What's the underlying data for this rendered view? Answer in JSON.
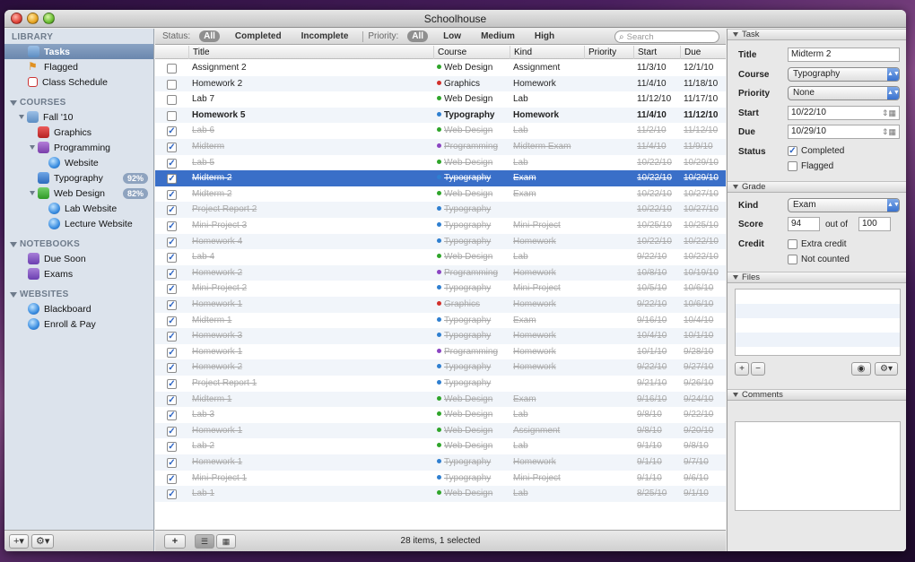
{
  "window": {
    "title": "Schoolhouse"
  },
  "sidebar": {
    "library_label": "LIBRARY",
    "library": [
      {
        "label": "Tasks",
        "icon": "tasks-icon",
        "selected": true
      },
      {
        "label": "Flagged",
        "icon": "flag-icon"
      },
      {
        "label": "Class Schedule",
        "icon": "calendar-icon"
      }
    ],
    "courses_label": "COURSES",
    "courses": [
      {
        "label": "Fall '10",
        "icon": "folder-icon",
        "indent": 1,
        "disclosure": true
      },
      {
        "label": "Graphics",
        "icon": "book-icon",
        "color": "red",
        "indent": 2
      },
      {
        "label": "Programming",
        "icon": "book-icon",
        "color": "purple",
        "indent": 2,
        "disclosure": true
      },
      {
        "label": "Website",
        "icon": "globe-icon",
        "indent": 3
      },
      {
        "label": "Typography",
        "icon": "book-icon",
        "color": "blue",
        "indent": 2,
        "badge": "92%"
      },
      {
        "label": "Web Design",
        "icon": "book-icon",
        "color": "green",
        "indent": 2,
        "disclosure": true,
        "badge": "82%"
      },
      {
        "label": "Lab Website",
        "icon": "globe-icon",
        "indent": 3
      },
      {
        "label": "Lecture Website",
        "icon": "globe-icon",
        "indent": 3
      }
    ],
    "notebooks_label": "NOTEBOOKS",
    "notebooks": [
      {
        "label": "Due Soon",
        "icon": "notebook-icon"
      },
      {
        "label": "Exams",
        "icon": "notebook-icon"
      }
    ],
    "websites_label": "WEBSITES",
    "websites": [
      {
        "label": "Blackboard",
        "icon": "globe-icon"
      },
      {
        "label": "Enroll & Pay",
        "icon": "globe-icon"
      }
    ],
    "footer": {
      "add": "+▾",
      "gear": "⚙▾"
    }
  },
  "filters": {
    "status_label": "Status:",
    "status": [
      "All",
      "Completed",
      "Incomplete"
    ],
    "status_selected": 0,
    "priority_label": "Priority:",
    "priority": [
      "All",
      "Low",
      "Medium",
      "High"
    ],
    "priority_selected": 0,
    "search_placeholder": "Search"
  },
  "columns": [
    "Title",
    "Course",
    "Kind",
    "Priority",
    "Start",
    "Due"
  ],
  "course_colors": {
    "Web Design": "#2fa52a",
    "Graphics": "#d2302b",
    "Typography": "#2f7fd0",
    "Programming": "#8b45c2"
  },
  "tasks": [
    {
      "done": false,
      "bold": false,
      "title": "Assignment 2",
      "course": "Web Design",
      "kind": "Assignment",
      "priority": "",
      "start": "11/3/10",
      "due": "12/1/10"
    },
    {
      "done": false,
      "bold": false,
      "title": "Homework 2",
      "course": "Graphics",
      "kind": "Homework",
      "priority": "",
      "start": "11/4/10",
      "due": "11/18/10"
    },
    {
      "done": false,
      "bold": false,
      "title": "Lab 7",
      "course": "Web Design",
      "kind": "Lab",
      "priority": "",
      "start": "11/12/10",
      "due": "11/17/10"
    },
    {
      "done": false,
      "bold": true,
      "title": "Homework 5",
      "course": "Typography",
      "kind": "Homework",
      "priority": "",
      "start": "11/4/10",
      "due": "11/12/10"
    },
    {
      "done": true,
      "bold": false,
      "title": "Lab 6",
      "course": "Web Design",
      "kind": "Lab",
      "priority": "",
      "start": "11/2/10",
      "due": "11/12/10"
    },
    {
      "done": true,
      "bold": false,
      "title": "Midterm",
      "course": "Programming",
      "kind": "Midterm Exam",
      "priority": "",
      "start": "11/4/10",
      "due": "11/9/10"
    },
    {
      "done": true,
      "bold": false,
      "title": "Lab 5",
      "course": "Web Design",
      "kind": "Lab",
      "priority": "",
      "start": "10/22/10",
      "due": "10/29/10"
    },
    {
      "done": true,
      "bold": false,
      "title": "Midterm 2",
      "course": "Typography",
      "kind": "Exam",
      "priority": "",
      "start": "10/22/10",
      "due": "10/29/10",
      "selected": true
    },
    {
      "done": true,
      "bold": false,
      "title": "Midterm 2",
      "course": "Web Design",
      "kind": "Exam",
      "priority": "",
      "start": "10/22/10",
      "due": "10/27/10"
    },
    {
      "done": true,
      "bold": false,
      "title": "Project Report 2",
      "course": "Typography",
      "kind": "",
      "priority": "",
      "start": "10/22/10",
      "due": "10/27/10"
    },
    {
      "done": true,
      "bold": false,
      "title": "Mini-Project 3",
      "course": "Typography",
      "kind": "Mini-Project",
      "priority": "",
      "start": "10/25/10",
      "due": "10/25/10"
    },
    {
      "done": true,
      "bold": false,
      "title": "Homework 4",
      "course": "Typography",
      "kind": "Homework",
      "priority": "",
      "start": "10/22/10",
      "due": "10/22/10"
    },
    {
      "done": true,
      "bold": false,
      "title": "Lab 4",
      "course": "Web Design",
      "kind": "Lab",
      "priority": "",
      "start": "9/22/10",
      "due": "10/22/10"
    },
    {
      "done": true,
      "bold": false,
      "title": "Homework 2",
      "course": "Programming",
      "kind": "Homework",
      "priority": "",
      "start": "10/8/10",
      "due": "10/19/10"
    },
    {
      "done": true,
      "bold": false,
      "title": "Mini-Project 2",
      "course": "Typography",
      "kind": "Mini-Project",
      "priority": "",
      "start": "10/5/10",
      "due": "10/6/10"
    },
    {
      "done": true,
      "bold": false,
      "title": "Homework 1",
      "course": "Graphics",
      "kind": "Homework",
      "priority": "",
      "start": "9/22/10",
      "due": "10/6/10"
    },
    {
      "done": true,
      "bold": false,
      "title": "Midterm 1",
      "course": "Typography",
      "kind": "Exam",
      "priority": "",
      "start": "9/16/10",
      "due": "10/4/10"
    },
    {
      "done": true,
      "bold": false,
      "title": "Homework 3",
      "course": "Typography",
      "kind": "Homework",
      "priority": "",
      "start": "10/4/10",
      "due": "10/1/10"
    },
    {
      "done": true,
      "bold": false,
      "title": "Homework 1",
      "course": "Programming",
      "kind": "Homework",
      "priority": "",
      "start": "10/1/10",
      "due": "9/28/10"
    },
    {
      "done": true,
      "bold": false,
      "title": "Homework 2",
      "course": "Typography",
      "kind": "Homework",
      "priority": "",
      "start": "9/22/10",
      "due": "9/27/10"
    },
    {
      "done": true,
      "bold": false,
      "title": "Project Report 1",
      "course": "Typography",
      "kind": "",
      "priority": "",
      "start": "9/21/10",
      "due": "9/26/10"
    },
    {
      "done": true,
      "bold": false,
      "title": "Midterm 1",
      "course": "Web Design",
      "kind": "Exam",
      "priority": "",
      "start": "9/16/10",
      "due": "9/24/10"
    },
    {
      "done": true,
      "bold": false,
      "title": "Lab 3",
      "course": "Web Design",
      "kind": "Lab",
      "priority": "",
      "start": "9/8/10",
      "due": "9/22/10"
    },
    {
      "done": true,
      "bold": false,
      "title": "Homework 1",
      "course": "Web Design",
      "kind": "Assignment",
      "priority": "",
      "start": "9/8/10",
      "due": "9/20/10"
    },
    {
      "done": true,
      "bold": false,
      "title": "Lab 2",
      "course": "Web Design",
      "kind": "Lab",
      "priority": "",
      "start": "9/1/10",
      "due": "9/8/10"
    },
    {
      "done": true,
      "bold": false,
      "title": "Homework 1",
      "course": "Typography",
      "kind": "Homework",
      "priority": "",
      "start": "9/1/10",
      "due": "9/7/10"
    },
    {
      "done": true,
      "bold": false,
      "title": "Mini-Project 1",
      "course": "Typography",
      "kind": "Mini-Project",
      "priority": "",
      "start": "9/1/10",
      "due": "9/6/10"
    },
    {
      "done": true,
      "bold": false,
      "title": "Lab 1",
      "course": "Web Design",
      "kind": "Lab",
      "priority": "",
      "start": "8/25/10",
      "due": "9/1/10"
    }
  ],
  "status_bar": {
    "count": "28 items, 1 selected"
  },
  "inspector": {
    "task_header": "Task",
    "title_label": "Title",
    "title_value": "Midterm 2",
    "course_label": "Course",
    "course_value": "Typography",
    "priority_label": "Priority",
    "priority_value": "None",
    "start_label": "Start",
    "start_value": "10/22/10",
    "due_label": "Due",
    "due_value": "10/29/10",
    "status_label": "Status",
    "completed_label": "Completed",
    "completed_checked": true,
    "flagged_label": "Flagged",
    "flagged_checked": false,
    "grade_header": "Grade",
    "kind_label": "Kind",
    "kind_value": "Exam",
    "score_label": "Score",
    "score_value": "94",
    "out_of_label": "out of",
    "out_of_value": "100",
    "credit_label": "Credit",
    "extra_credit_label": "Extra credit",
    "extra_credit_checked": false,
    "not_counted_label": "Not counted",
    "not_counted_checked": false,
    "files_header": "Files",
    "comments_header": "Comments"
  }
}
